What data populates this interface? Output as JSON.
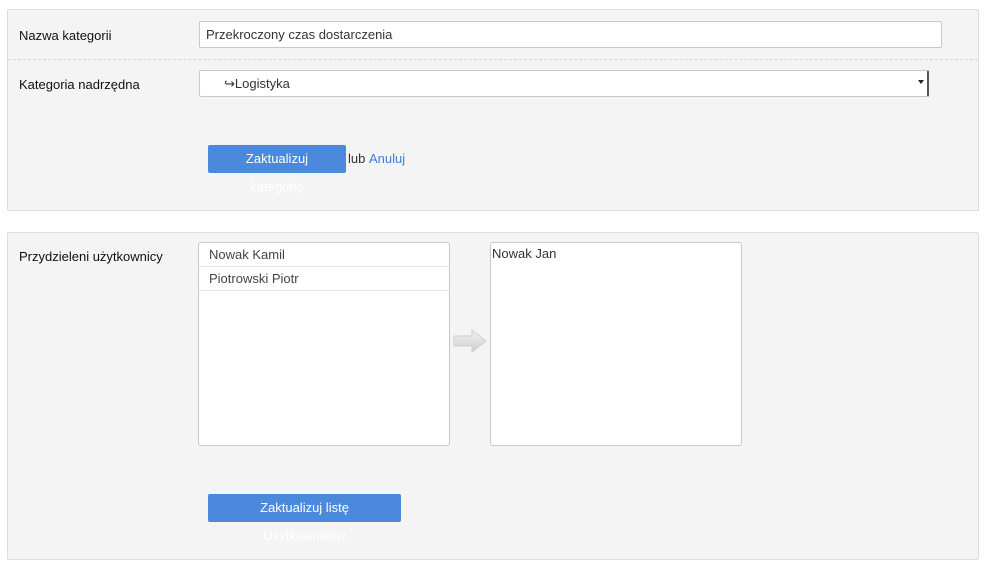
{
  "category_form": {
    "name_label": "Nazwa kategorii",
    "name_value": "Przekroczony czas dostarczenia",
    "parent_label": "Kategoria nadrzędna",
    "parent_selected": "↪Logistyka",
    "update_button": "Zaktualizuj kategorię",
    "or_text": "lub",
    "cancel_link": "Anuluj"
  },
  "users_form": {
    "label": "Przydzieleni użytkownicy",
    "available_users": [
      "Nowak Kamil",
      "Piotrowski Piotr"
    ],
    "assigned_users": [
      "Nowak Jan"
    ],
    "update_button": "Zaktualizuj listę Użytkowników",
    "arrow_icon": "arrow-right-icon"
  },
  "colors": {
    "accent": "#4a89dc",
    "panel_bg": "#f4f4f4",
    "link": "#3a7fd5"
  }
}
